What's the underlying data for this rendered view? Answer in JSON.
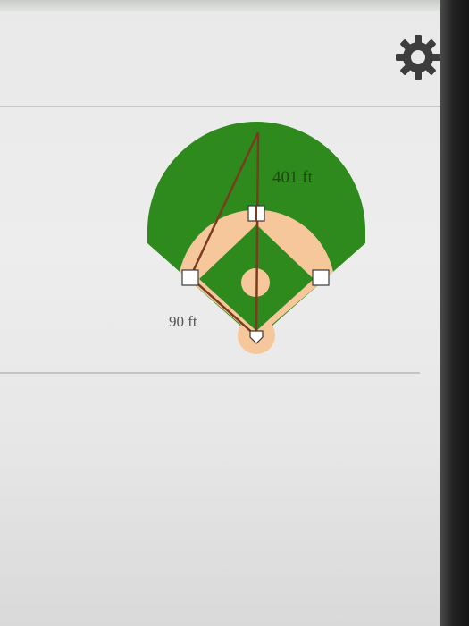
{
  "settings": {
    "icon": "gear-icon",
    "color": "#3d3d3d"
  },
  "field": {
    "center_field_distance": "401 ft",
    "base_distance": "90 ft",
    "colors": {
      "grass": "#2e8a1d",
      "dirt": "#f5c79a",
      "lines": "#7a3b1e",
      "bases": "#ffffff"
    }
  }
}
